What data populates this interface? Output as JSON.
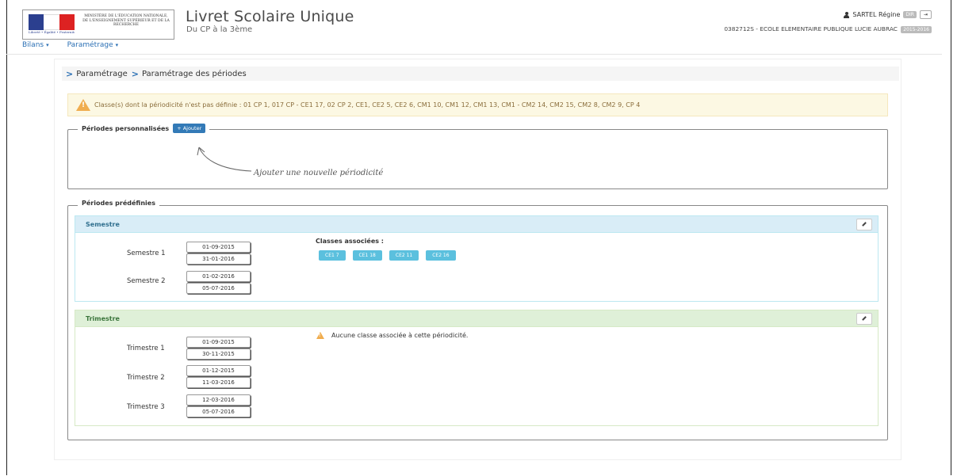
{
  "header": {
    "ministry_text": "MINISTÈRE DE L'ÉDUCATION NATIONALE, DE L'ENSEIGNEMENT SUPÉRIEUR ET DE LA RECHERCHE",
    "flag_caption": "Liberté • Égalité • Fraternité RÉPUBLIQUE FRANÇAISE",
    "app_title": "Livret Scolaire Unique",
    "app_subtitle": "Du CP à la 3ème",
    "user_name": "SARTEL Régine",
    "user_role_badge": "DIR",
    "logout_label": "⇥",
    "school": "0382712S - ECOLE ELEMENTAIRE PUBLIQUE LUCIE AUBRAC",
    "school_year": "2015-2016"
  },
  "nav": {
    "items": [
      {
        "label": "Bilans"
      },
      {
        "label": "Paramétrage"
      }
    ]
  },
  "breadcrumb": {
    "items": [
      "Paramétrage",
      "Paramétrage des périodes"
    ]
  },
  "alert": {
    "text": "Classe(s) dont la périodicité n'est pas définie : 01 CP 1, 017 CP - CE1 17, 02 CP 2, CE1, CE2 5, CE2 6, CM1 10, CM1 12, CM1 13, CM1 - CM2 14, CM2 15, CM2 8, CM2 9, CP 4"
  },
  "custom_periods": {
    "legend": "Périodes personnalisées",
    "add_button": "+ Ajouter",
    "annotation": "Ajouter une nouvelle périodicité"
  },
  "predefined": {
    "legend": "Périodes prédéfinies",
    "semestre": {
      "title": "Semestre",
      "associated_title": "Classes associées :",
      "classes": [
        "CE1 7",
        "CE1 18",
        "CE2 11",
        "CE2 16"
      ],
      "periods": [
        {
          "label": "Semestre 1",
          "start": "01-09-2015",
          "end": "31-01-2016"
        },
        {
          "label": "Semestre 2",
          "start": "01-02-2016",
          "end": "05-07-2016"
        }
      ]
    },
    "trimestre": {
      "title": "Trimestre",
      "no_class_text": "Aucune classe associée à cette périodicité.",
      "periods": [
        {
          "label": "Trimestre 1",
          "start": "01-09-2015",
          "end": "30-11-2015"
        },
        {
          "label": "Trimestre 2",
          "start": "01-12-2015",
          "end": "11-03-2016"
        },
        {
          "label": "Trimestre 3",
          "start": "12-03-2016",
          "end": "05-07-2016"
        }
      ]
    }
  },
  "colors": {
    "link": "#2a6fb4",
    "info_header": "#d9edf7",
    "success_header": "#dff0d8",
    "chip": "#5bc0de",
    "warning": "#f0ad4e"
  }
}
